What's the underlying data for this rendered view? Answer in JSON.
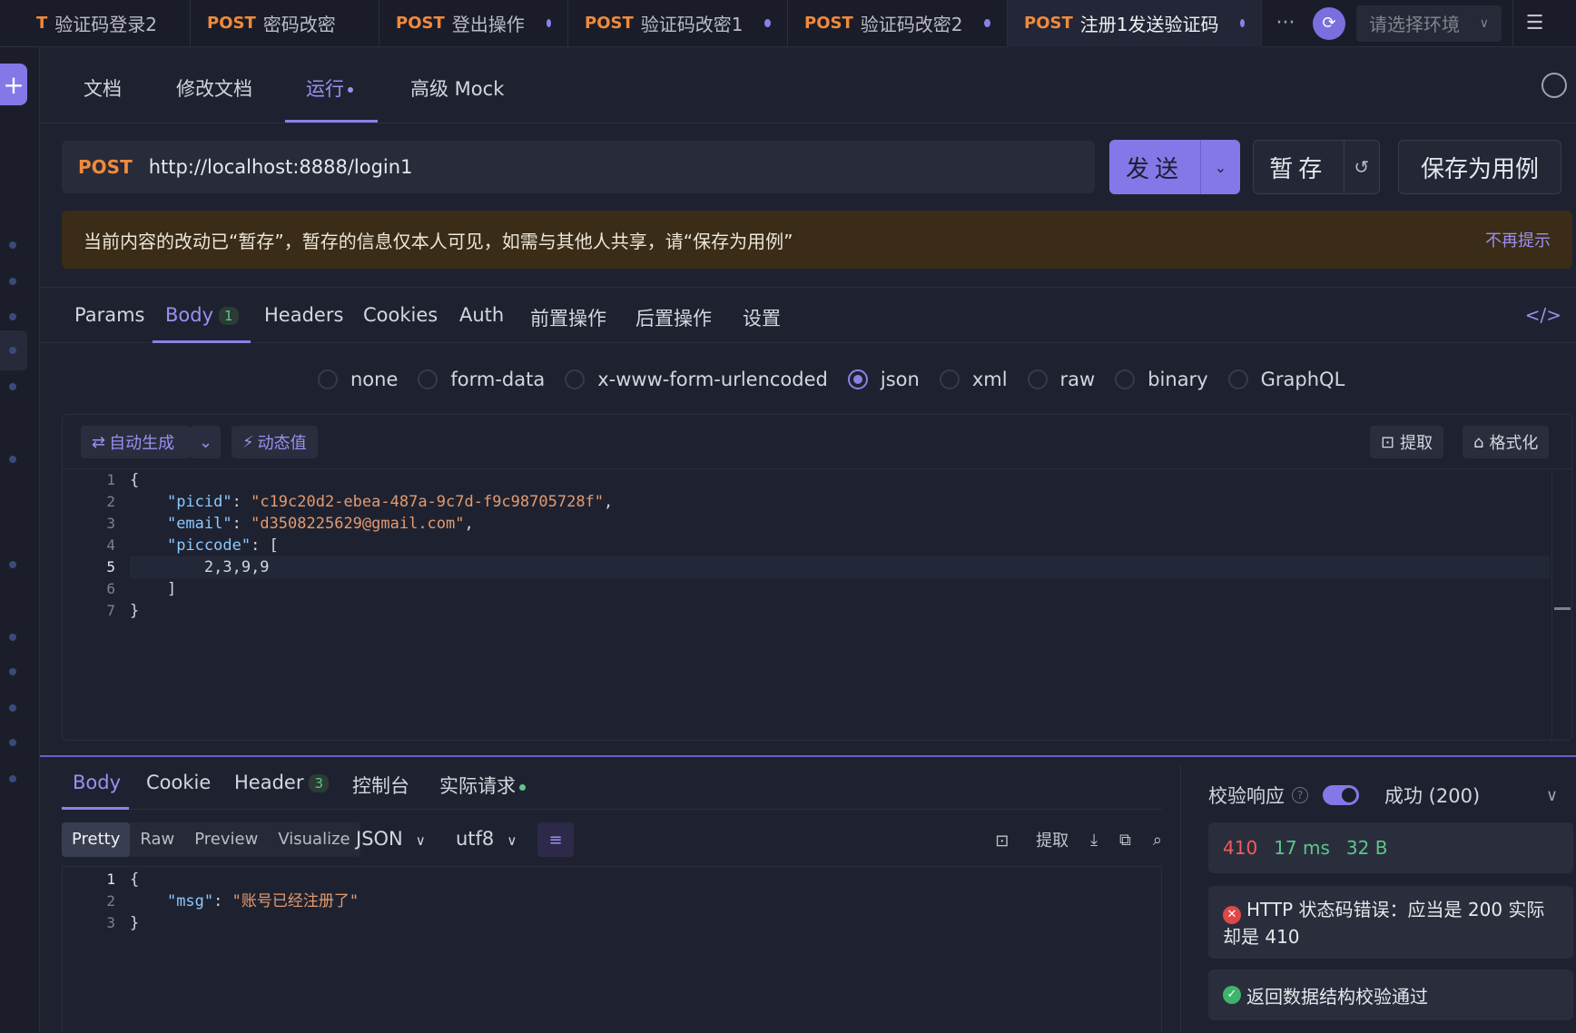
{
  "tabs": [
    {
      "method": "T",
      "label": "验证码登录2",
      "dot": false
    },
    {
      "method": "POST",
      "label": "密码改密",
      "dot": false
    },
    {
      "method": "POST",
      "label": "登出操作",
      "dot": true
    },
    {
      "method": "POST",
      "label": "验证码改密1",
      "dot": true
    },
    {
      "method": "POST",
      "label": "验证码改密2",
      "dot": true
    },
    {
      "method": "POST",
      "label": "注册1发送验证码",
      "dot": true
    }
  ],
  "top": {
    "more": "···",
    "env_placeholder": "请选择环境"
  },
  "subtabs": [
    "文档",
    "修改文档",
    "运行",
    "高级 Mock"
  ],
  "request": {
    "method": "POST",
    "url": "http://localhost:8888/login1",
    "send_label": "发送",
    "stash_label": "暂存",
    "save_case_label": "保存为用例"
  },
  "notice": {
    "text": "当前内容的改动已“暂存”，暂存的信息仅本人可见，如需与其他人共享，请“保存为用例”",
    "dismiss": "不再提示"
  },
  "request_tabs": {
    "params": "Params",
    "body": "Body",
    "body_count": "1",
    "headers": "Headers",
    "cookies": "Cookies",
    "auth": "Auth",
    "pre": "前置操作",
    "post": "后置操作",
    "settings": "设置"
  },
  "body_types": [
    "none",
    "form-data",
    "x-www-form-urlencoded",
    "json",
    "xml",
    "raw",
    "binary",
    "GraphQL"
  ],
  "body_selected": "json",
  "editor": {
    "auto_gen": "自动生成",
    "dynamic": "动态值",
    "extract": "提取",
    "format": "格式化",
    "line_numbers": [
      "1",
      "2",
      "3",
      "4",
      "5",
      "6",
      "7"
    ],
    "picid_key": "\"picid\"",
    "picid_val": "\"c19c20d2-ebea-487a-9c7d-f9c98705728f\"",
    "email_key": "\"email\"",
    "email_val": "\"d3508225629@gmail.com\"",
    "piccode_key": "\"piccode\"",
    "piccode_val": "2,3,9,9"
  },
  "response_tabs": {
    "body": "Body",
    "cookie": "Cookie",
    "header": "Header",
    "header_count": "3",
    "console": "控制台",
    "actual": "实际请求"
  },
  "response_toolbar": {
    "views": [
      "Pretty",
      "Raw",
      "Preview",
      "Visualize"
    ],
    "format": "JSON",
    "encoding": "utf8",
    "extract": "提取"
  },
  "response_body": {
    "line_numbers": [
      "1",
      "2",
      "3"
    ],
    "msg_key": "\"msg\"",
    "msg_val": "\"账号已经注册了\""
  },
  "validation": {
    "label": "校验响应",
    "result": "成功 (200)",
    "status": "410",
    "time": "17 ms",
    "size": "32 B",
    "error": "HTTP 状态码错误：应当是 200 实际却是 410",
    "passed": "返回数据结构校验通过"
  }
}
